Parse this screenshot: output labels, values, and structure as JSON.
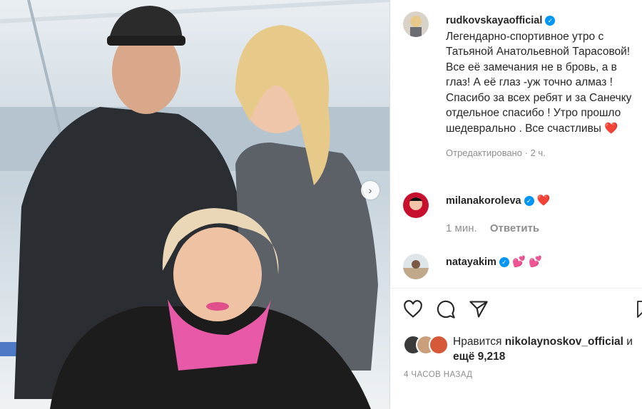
{
  "post": {
    "author": "rudkovskayaofficial",
    "caption": "Легендарно-спортивное утро с Татьяной Анатольевной Тарасовой! Все её замечания не в бровь, а в глаз! А её глаз -уж точно алмаз ! Спасибо за всех ребят и за Санечку отдельное спасибо ! Утро прошло шедеврально . Все счастливы",
    "caption_emoji": "❤️",
    "edited": "Отредактировано",
    "edited_sep": "·",
    "edited_time": "2 ч."
  },
  "comments": [
    {
      "user": "milanakoroleva",
      "text": "❤️",
      "time": "1 мин.",
      "reply": "Ответить"
    },
    {
      "user": "natayakim",
      "text": "💕 💕"
    }
  ],
  "likes": {
    "prefix": "Нравится",
    "user": "nikolaynoskov_official",
    "suffix": "и",
    "more": "ещё 9,218"
  },
  "timestamp": "4 ЧАСОВ НАЗАД",
  "icons": [
    "heart-icon",
    "comment-icon",
    "share-icon",
    "bookmark-icon",
    "chevron-right-icon",
    "verified-icon"
  ],
  "colors": {
    "verified": "#0095f6",
    "heart": "#ed4956",
    "muted": "#8e8e8e"
  }
}
